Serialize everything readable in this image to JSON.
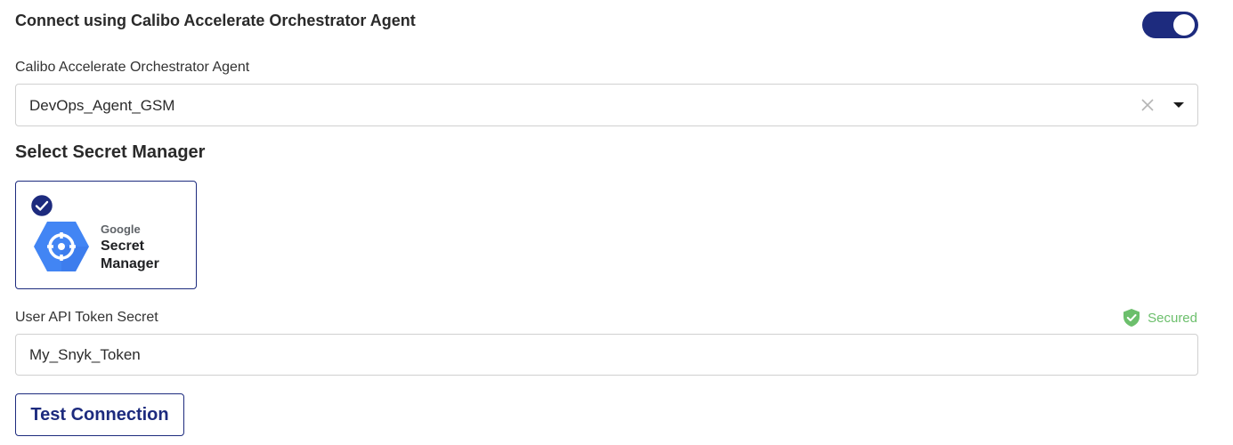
{
  "connect": {
    "title": "Connect using Calibo Accelerate Orchestrator Agent",
    "toggle_on": true
  },
  "agent": {
    "label": "Calibo Accelerate Orchestrator Agent",
    "selected": "DevOps_Agent_GSM"
  },
  "secret_manager": {
    "section_title": "Select Secret Manager",
    "options": [
      {
        "brand_prefix": "Google",
        "name_line1": "Secret",
        "name_line2": "Manager",
        "selected": true
      }
    ]
  },
  "token": {
    "label": "User API Token Secret",
    "status": "Secured",
    "value": "My_Snyk_Token"
  },
  "actions": {
    "test_connection": "Test Connection"
  },
  "colors": {
    "accent": "#1d2b7e",
    "secured": "#6cbf6c",
    "google_blue": "#4285f4"
  },
  "icons": [
    "toggle-switch",
    "clear-icon",
    "caret-down-icon",
    "check-circle-icon",
    "google-secret-manager-logo",
    "shield-check-icon"
  ]
}
